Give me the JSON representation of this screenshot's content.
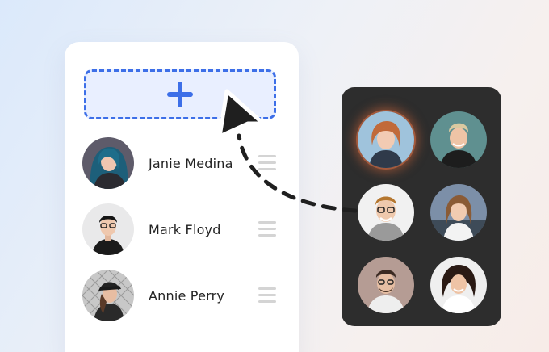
{
  "list": {
    "add_icon": "plus-icon",
    "items": [
      {
        "name": "Janie Medina"
      },
      {
        "name": "Mark Floyd"
      },
      {
        "name": "Annie Perry"
      }
    ]
  },
  "grid": {
    "avatars": [
      "avatar-1",
      "avatar-2",
      "avatar-3",
      "avatar-4",
      "avatar-5",
      "avatar-6"
    ]
  },
  "colors": {
    "accent": "#3d6fe8",
    "panel": "#2d2d2d",
    "cursor": "#1f1f1f",
    "dropzone_bg": "#e9efff"
  },
  "icons": [
    "plus-icon",
    "cursor-arrow-icon",
    "drag-handle-icon"
  ]
}
